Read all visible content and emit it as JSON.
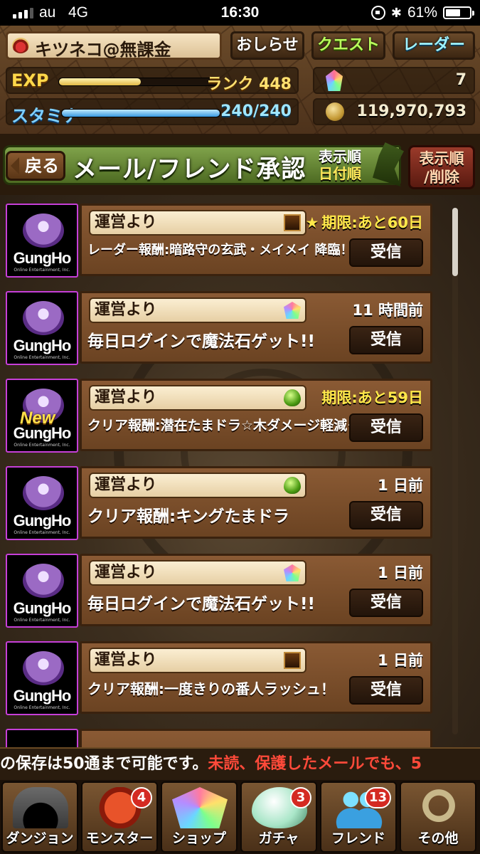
{
  "status_bar": {
    "carrier": "au",
    "network": "4G",
    "time": "16:30",
    "battery": "61%",
    "battery_level": 0.61
  },
  "header": {
    "player_name": "キツネコ@無課金",
    "buttons": {
      "news": "おしらせ",
      "quest": "クエスト",
      "radar": "レーダー"
    },
    "exp": {
      "label": "EXP",
      "value": "ランク 448",
      "level": 0.52
    },
    "stamina": {
      "label": "スタミナ",
      "value": "240/240",
      "level": 1.0
    },
    "magic_stones": "7",
    "coins": "119,970,793"
  },
  "title_bar": {
    "back": "戻る",
    "title": "メール/フレンド承認",
    "sort_label": "表示順",
    "sort_value": "日付順",
    "sort_delete_line1": "表示順",
    "sort_delete_line2": "/削除"
  },
  "mails": [
    {
      "sender": "運営より",
      "gift": "chest",
      "when": "期限:あと60日",
      "deadline": true,
      "starred": true,
      "subject": "レーダー報酬:暗路守の玄武・メイメイ 降臨！",
      "subject_size": 18,
      "is_new": false,
      "receive": "受信"
    },
    {
      "sender": "運営より",
      "gift": "stone",
      "when": "11 時間前",
      "deadline": false,
      "starred": false,
      "subject": "毎日ログインで魔法石ゲット!!",
      "subject_size": 23,
      "is_new": false,
      "receive": "受信"
    },
    {
      "sender": "運営より",
      "gift": "egg",
      "when": "期限:あと59日",
      "deadline": true,
      "starred": false,
      "subject": "クリア報酬:潜在たまドラ☆木ダメージ軽減＋",
      "subject_size": 19,
      "is_new": true,
      "receive": "受信"
    },
    {
      "sender": "運営より",
      "gift": "egg",
      "when": "1 日前",
      "deadline": false,
      "starred": false,
      "subject": "クリア報酬:キングたまドラ",
      "subject_size": 23,
      "is_new": false,
      "receive": "受信"
    },
    {
      "sender": "運営より",
      "gift": "stone",
      "when": "1 日前",
      "deadline": false,
      "starred": false,
      "subject": "毎日ログインで魔法石ゲット!!",
      "subject_size": 23,
      "is_new": false,
      "receive": "受信"
    },
    {
      "sender": "運営より",
      "gift": "chest",
      "when": "1 日前",
      "deadline": false,
      "starred": false,
      "subject": "クリア報酬:一度きりの番人ラッシュ！",
      "subject_size": 20,
      "is_new": false,
      "receive": "受信"
    }
  ],
  "avatar": {
    "logo": "GungHo",
    "sub": "Online Entertainment, Inc.",
    "new_label": "New"
  },
  "ticker": {
    "part1": "の保存は50通まで可能です。",
    "part2": "未読、保護したメールでも、5"
  },
  "nav": [
    {
      "key": "dungeon",
      "label": "ダンジョン",
      "badge": ""
    },
    {
      "key": "monster",
      "label": "モンスター",
      "badge": "4"
    },
    {
      "key": "shop",
      "label": "ショップ",
      "badge": ""
    },
    {
      "key": "gacha",
      "label": "ガチャ",
      "badge": "3"
    },
    {
      "key": "friend",
      "label": "フレンド",
      "badge": "13"
    },
    {
      "key": "other",
      "label": "その他",
      "badge": ""
    }
  ],
  "colors": {
    "deadline_text": "#ffe84a",
    "ticker_warning": "#ff4a3a",
    "avatar_border": "#c63fd8"
  }
}
